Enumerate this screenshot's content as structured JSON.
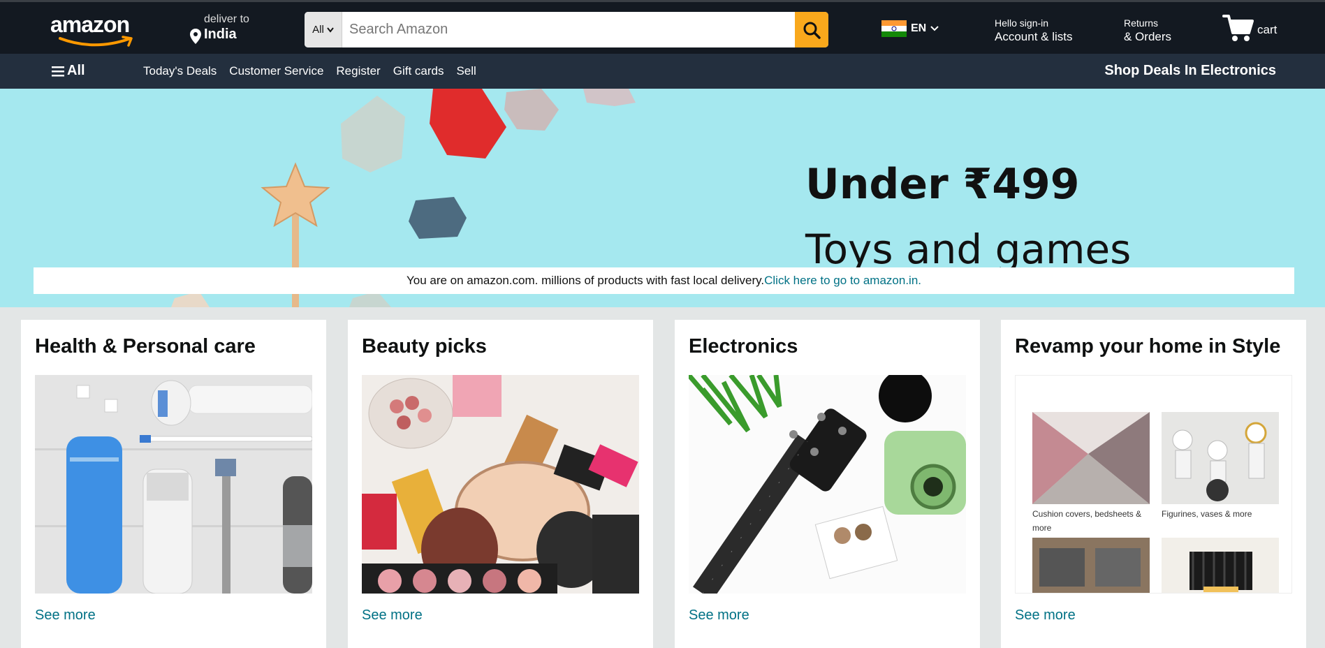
{
  "header": {
    "logo": "amazon",
    "deliver_label": "deliver to",
    "deliver_location": "India",
    "search_category": "All",
    "search_placeholder": "Search Amazon",
    "language": "EN",
    "account_greeting": "Hello sign-in",
    "account_label": "Account & lists",
    "returns_label": "Returns",
    "orders_label": "& Orders",
    "cart_label": "cart"
  },
  "subnav": {
    "all_label": "All",
    "links": [
      "Today's Deals",
      "Customer Service",
      "Register",
      "Gift cards",
      "Sell"
    ],
    "promo": "Shop Deals In Electronics"
  },
  "hero": {
    "headline": "Under ₹499",
    "subheadline": "Toys and games"
  },
  "notice": {
    "text": "You are on amazon.com. millions of products with fast local delivery.",
    "link": "Click here to go to amazon.in."
  },
  "cards": [
    {
      "title": "Health & Personal care",
      "link": "See more"
    },
    {
      "title": "Beauty picks",
      "link": "See more"
    },
    {
      "title": "Electronics",
      "link": "See more"
    },
    {
      "title": "Revamp your home in Style",
      "link": "See more",
      "tiles": [
        "Cushion covers, bedsheets & more",
        "Figurines, vases & more"
      ]
    }
  ],
  "colors": {
    "nav_bg": "#131921",
    "subnav_bg": "#232f3e",
    "search_button": "#f9a81c",
    "link": "#007185",
    "hero_bg": "#a5e8ef",
    "page_bg": "#e3e6e6"
  },
  "icons": [
    "map-pin-icon",
    "chevron-down-icon",
    "search-icon",
    "india-flag-icon",
    "cart-icon",
    "hamburger-menu-icon"
  ]
}
